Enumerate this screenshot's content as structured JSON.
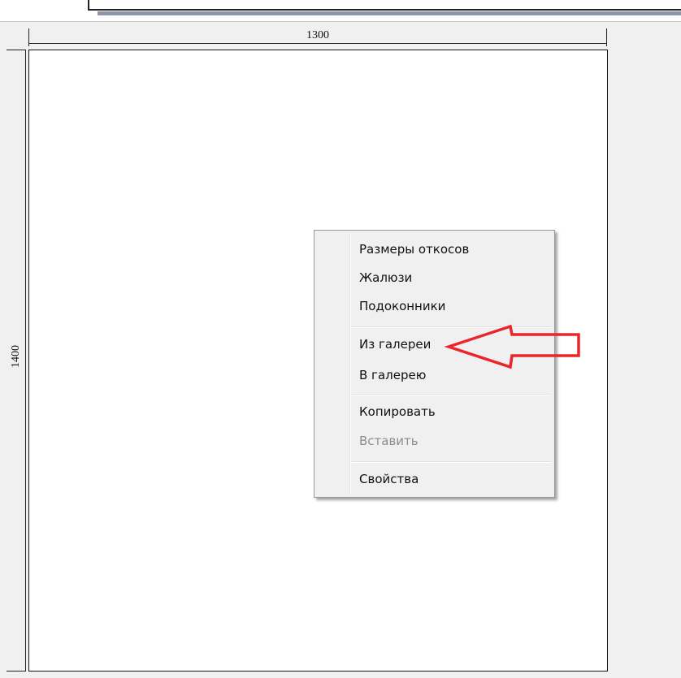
{
  "drawing": {
    "width_label": "1300",
    "height_label": "1400"
  },
  "context_menu": {
    "items": [
      {
        "label": "Размеры откосов",
        "enabled": true
      },
      {
        "label": "Жалюзи",
        "enabled": true
      },
      {
        "label": "Подоконники",
        "enabled": true
      },
      {
        "label": "Из галереи",
        "enabled": true
      },
      {
        "label": "В галерею",
        "enabled": true
      },
      {
        "label": "Копировать",
        "enabled": true
      },
      {
        "label": "Вставить",
        "enabled": false
      },
      {
        "label": "Свойства",
        "enabled": true
      }
    ]
  },
  "annotation": {
    "arrow_color": "#e8262b",
    "arrow_icon": "left-arrow-outline-icon",
    "points_to": "Из галереи"
  },
  "colors": {
    "menu_background": "#f0f0f0",
    "disabled_text": "#8d8d8d"
  }
}
